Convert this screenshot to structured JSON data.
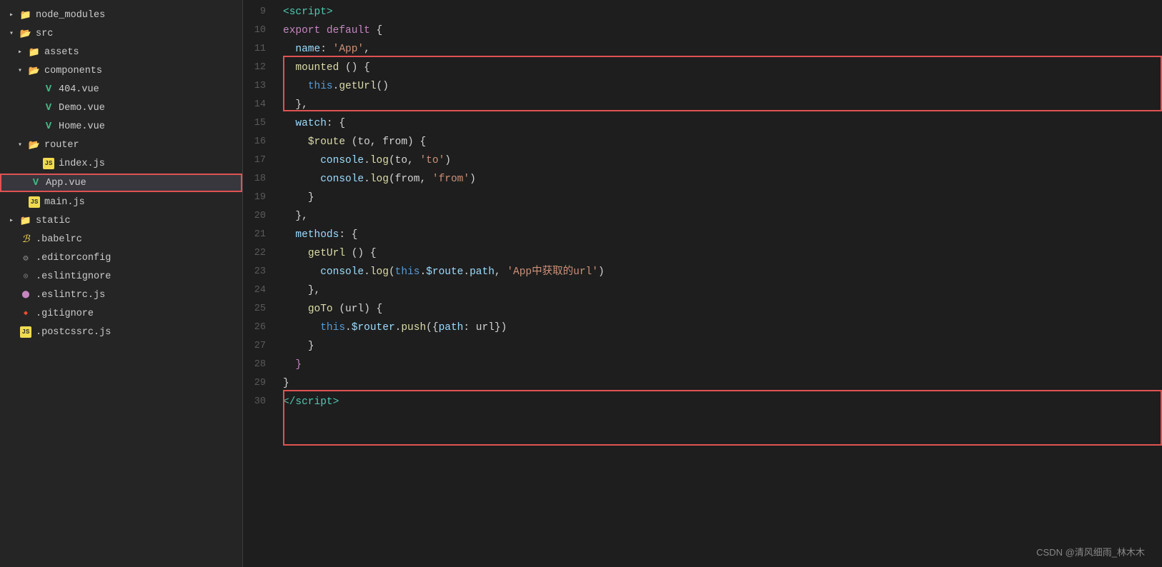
{
  "sidebar": {
    "items": [
      {
        "id": "node_modules",
        "label": "node_modules",
        "type": "folder",
        "indent": 0,
        "state": "closed"
      },
      {
        "id": "src",
        "label": "src",
        "type": "folder",
        "indent": 0,
        "state": "open"
      },
      {
        "id": "assets",
        "label": "assets",
        "type": "folder",
        "indent": 1,
        "state": "closed"
      },
      {
        "id": "components",
        "label": "components",
        "type": "folder",
        "indent": 1,
        "state": "open"
      },
      {
        "id": "404vue",
        "label": "404.vue",
        "type": "vue",
        "indent": 2
      },
      {
        "id": "Demovue",
        "label": "Demo.vue",
        "type": "vue",
        "indent": 2
      },
      {
        "id": "Homevue",
        "label": "Home.vue",
        "type": "vue",
        "indent": 2
      },
      {
        "id": "router",
        "label": "router",
        "type": "folder",
        "indent": 1,
        "state": "open"
      },
      {
        "id": "indexjs",
        "label": "index.js",
        "type": "js",
        "indent": 2
      },
      {
        "id": "Appvue",
        "label": "App.vue",
        "type": "vue",
        "indent": 1,
        "selected": true
      },
      {
        "id": "mainjs",
        "label": "main.js",
        "type": "js",
        "indent": 1
      },
      {
        "id": "static",
        "label": "static",
        "type": "folder",
        "indent": 0,
        "state": "closed"
      },
      {
        "id": "babelrc",
        "label": ".babelrc",
        "type": "babel",
        "indent": 0
      },
      {
        "id": "editorconfig",
        "label": ".editorconfig",
        "type": "gear",
        "indent": 0
      },
      {
        "id": "eslintignore",
        "label": ".eslintignore",
        "type": "circle",
        "indent": 0
      },
      {
        "id": "eslintrcjs",
        "label": ".eslintrc.js",
        "type": "circle2",
        "indent": 0
      },
      {
        "id": "gitignore",
        "label": ".gitignore",
        "type": "diamond",
        "indent": 0
      },
      {
        "id": "postcssrcjs",
        "label": ".postcssrc.js",
        "type": "js",
        "indent": 0
      }
    ]
  },
  "editor": {
    "lines": [
      {
        "num": 9,
        "html": "<span class='tag'>&lt;script&gt;</span>"
      },
      {
        "num": 10,
        "html": "<span class='kw'>export</span> <span class='kw'>default</span> <span class='punct'>{</span>"
      },
      {
        "num": 11,
        "html": "  <span class='light-blue'>name</span><span class='punct'>:</span> <span class='str'>'App'</span><span class='punct'>,</span>"
      },
      {
        "num": 12,
        "html": "  <span class='yellow'>mounted</span> <span class='punct'>() {</span>",
        "highlight_start": 1
      },
      {
        "num": 13,
        "html": "    <span class='blue'>this</span><span class='punct'>.</span><span class='yellow'>getUrl</span><span class='punct'>()</span>"
      },
      {
        "num": 14,
        "html": "  <span class='punct'>},</span>",
        "highlight_end": 1
      },
      {
        "num": 15,
        "html": "  <span class='light-blue'>watch</span><span class='punct'>: {</span>"
      },
      {
        "num": 16,
        "html": "    <span class='yellow'>$route</span> <span class='punct'>(to, from) {</span>"
      },
      {
        "num": 17,
        "html": "      <span class='light-blue'>console</span><span class='punct'>.</span><span class='yellow'>log</span><span class='punct'>(to,</span> <span class='str'>'to'</span><span class='punct'>)</span>"
      },
      {
        "num": 18,
        "html": "      <span class='light-blue'>console</span><span class='punct'>.</span><span class='yellow'>log</span><span class='punct'>(from,</span> <span class='str'>'from'</span><span class='punct'>)</span>"
      },
      {
        "num": 19,
        "html": "    <span class='punct'>}</span>"
      },
      {
        "num": 20,
        "html": "  <span class='punct'>},</span>"
      },
      {
        "num": 21,
        "html": "  <span class='light-blue'>methods</span><span class='punct'>: {</span>"
      },
      {
        "num": 22,
        "html": "    <span class='yellow'>getUrl</span> <span class='punct'>() {</span>",
        "highlight_start": 2
      },
      {
        "num": 23,
        "html": "      <span class='light-blue'>console</span><span class='punct'>.</span><span class='yellow'>log</span><span class='punct'>(</span><span class='blue'>this</span><span class='punct'>.</span><span class='light-blue'>$route</span><span class='punct'>.</span><span class='light-blue'>path</span><span class='punct'>,</span> <span class='str'>'App中获取的url'</span><span class='punct'>)</span>"
      },
      {
        "num": 24,
        "html": "    <span class='punct'>},</span>",
        "highlight_end": 2
      },
      {
        "num": 25,
        "html": "    <span class='yellow'>goTo</span> <span class='punct'>(url) {</span>"
      },
      {
        "num": 26,
        "html": "      <span class='blue'>this</span><span class='punct'>.</span><span class='light-blue'>$router</span><span class='punct'>.</span><span class='yellow'>push</span><span class='punct'>({</span><span class='light-blue'>path</span><span class='punct'>: url})</span>"
      },
      {
        "num": 27,
        "html": "    <span class='punct'>}</span>"
      },
      {
        "num": 28,
        "html": "  <span class='purple'>}</span>"
      },
      {
        "num": 29,
        "html": "<span class='punct'>}</span>"
      },
      {
        "num": 30,
        "html": "<span class='tag'>&lt;/script&gt;</span>"
      }
    ]
  },
  "watermark": {
    "text": "CSDN @清风细雨_林木木"
  }
}
